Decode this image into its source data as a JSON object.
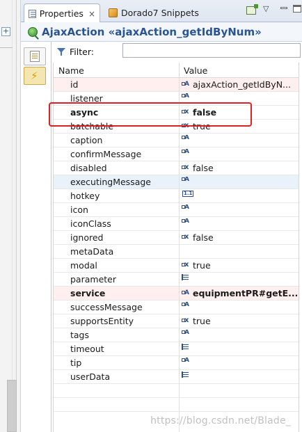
{
  "tabs": [
    {
      "label": "Properties",
      "icon": "properties-icon",
      "active": true,
      "close_glyph": "×"
    },
    {
      "label": "Dorado7 Snippets",
      "icon": "snippets-icon",
      "active": false
    }
  ],
  "view_controls": {
    "chevron": "▽"
  },
  "title": "AjaxAction «ajaxAction_getIdByNum»",
  "filter": {
    "label": "Filter:",
    "value": ""
  },
  "columns": {
    "name": "Name",
    "value": "Value"
  },
  "rows": [
    {
      "name": "id",
      "type": "str",
      "value": "ajaxAction_getIdByN...",
      "highlight": "hl",
      "bold": false
    },
    {
      "name": "listener",
      "type": "str",
      "value": "",
      "highlight": "",
      "bold": false
    },
    {
      "name": "async",
      "type": "bool",
      "value": "false",
      "highlight": "",
      "bold": true
    },
    {
      "name": "batchable",
      "type": "bool",
      "value": "true",
      "highlight": "",
      "bold": false
    },
    {
      "name": "caption",
      "type": "str",
      "value": "",
      "highlight": "",
      "bold": false
    },
    {
      "name": "confirmMessage",
      "type": "str",
      "value": "",
      "highlight": "",
      "bold": false
    },
    {
      "name": "disabled",
      "type": "bool",
      "value": "false",
      "highlight": "",
      "bold": false
    },
    {
      "name": "executingMessage",
      "type": "str",
      "value": "",
      "highlight": "sel",
      "bold": false
    },
    {
      "name": "hotkey",
      "type": "num",
      "value": "",
      "highlight": "",
      "bold": false
    },
    {
      "name": "icon",
      "type": "str",
      "value": "",
      "highlight": "",
      "bold": false
    },
    {
      "name": "iconClass",
      "type": "str",
      "value": "",
      "highlight": "",
      "bold": false
    },
    {
      "name": "ignored",
      "type": "bool",
      "value": "false",
      "highlight": "",
      "bold": false
    },
    {
      "name": "metaData",
      "type": "none",
      "value": "",
      "highlight": "",
      "bold": false
    },
    {
      "name": "modal",
      "type": "bool",
      "value": "true",
      "highlight": "",
      "bold": false
    },
    {
      "name": "parameter",
      "type": "list",
      "value": "",
      "highlight": "",
      "bold": false
    },
    {
      "name": "service",
      "type": "str",
      "value": "equipmentPR#getE...",
      "highlight": "hl",
      "bold": true
    },
    {
      "name": "successMessage",
      "type": "str",
      "value": "",
      "highlight": "",
      "bold": false
    },
    {
      "name": "supportsEntity",
      "type": "bool",
      "value": "true",
      "highlight": "",
      "bold": false
    },
    {
      "name": "tags",
      "type": "str",
      "value": "",
      "highlight": "",
      "bold": false
    },
    {
      "name": "timeout",
      "type": "list",
      "value": "",
      "highlight": "",
      "bold": false
    },
    {
      "name": "tip",
      "type": "str",
      "value": "",
      "highlight": "",
      "bold": false
    },
    {
      "name": "userData",
      "type": "list",
      "value": "",
      "highlight": "",
      "bold": false
    }
  ],
  "watermark": "https://blog.csdn.net/Blade_",
  "colors": {
    "annotation": "#e02020",
    "title": "#2a5594",
    "row_highlight": "#fff0ef",
    "row_selected": "#e9f1fb"
  }
}
